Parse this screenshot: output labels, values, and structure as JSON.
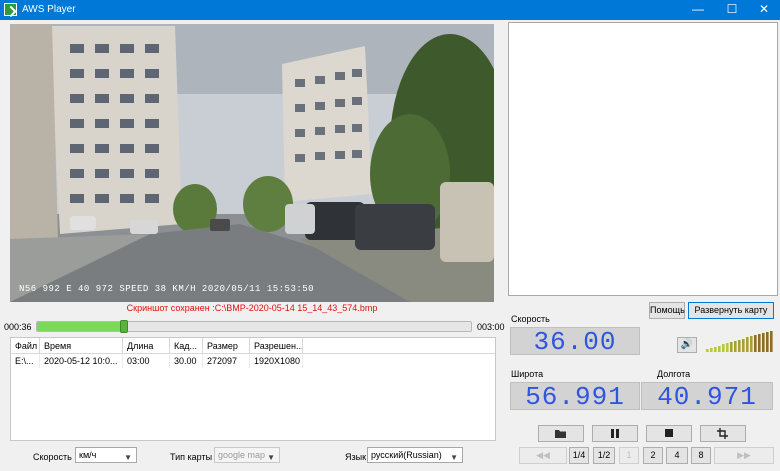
{
  "window": {
    "title": "AWS Player",
    "minimize": "—",
    "maximize": "☐",
    "close": "✕"
  },
  "video": {
    "osd": "N56 992 E 40 972 SPEED 38 KM/H 2020/05/11 15:53:50"
  },
  "status": {
    "saved_message": "Скриншот сохранен :C:\\BMP-2020-05-14 15_14_43_574.bmp"
  },
  "timeline": {
    "current": "000:36",
    "end": "003:00",
    "progress": 0.2
  },
  "table": {
    "headers": [
      "Файл",
      "Время",
      "Длина",
      "Кад...",
      "Размер",
      "Разрешен..."
    ],
    "rows": [
      [
        "E:\\...",
        "2020-05-12 10:0...",
        "03:00",
        "30.00",
        "272097",
        "1920X1080"
      ]
    ]
  },
  "settings": {
    "speed_label": "Скорость",
    "speed_value": "км/ч",
    "map_label": "Тип карты",
    "map_value": "google map",
    "lang_label": "Язык",
    "lang_value": "русский(Russian)"
  },
  "map_panel": {
    "help_button": "Помощь",
    "expand_button": "Развернуть карту"
  },
  "gauges": {
    "speed_label": "Скорость",
    "speed_value": "36.00",
    "lat_label": "Широта",
    "lat_value": "56.991",
    "lon_label": "Долгота",
    "lon_value": "40.971"
  },
  "icons": {
    "speaker": "speaker-icon",
    "open": "folder-open-icon",
    "pause": "pause-icon",
    "stop": "stop-icon",
    "crop": "crop-icon"
  },
  "playback_speed": [
    "◀◀",
    "1/4",
    "1/2",
    "1",
    "2",
    "4",
    "8",
    "▶▶"
  ],
  "colors": {
    "titlebar": "#0078d7",
    "lcd_text": "#2f55e0",
    "message": "#e01010",
    "progress": "#7dd85a"
  }
}
